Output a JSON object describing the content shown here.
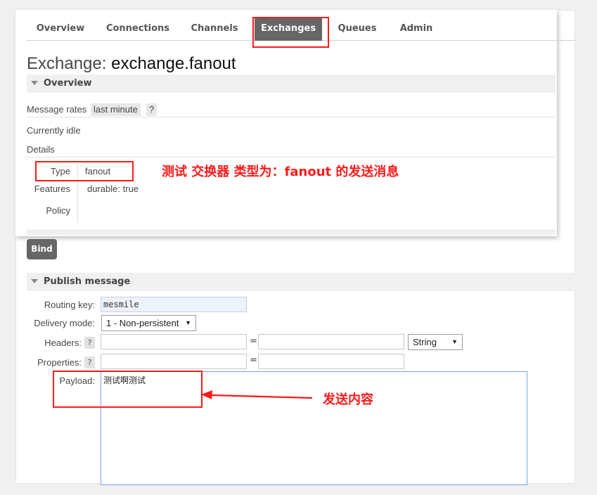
{
  "nav": {
    "tabs": [
      {
        "label": "Overview",
        "active": false
      },
      {
        "label": "Connections",
        "active": false
      },
      {
        "label": "Channels",
        "active": false
      },
      {
        "label": "Exchanges",
        "active": true
      },
      {
        "label": "Queues",
        "active": false
      },
      {
        "label": "Admin",
        "active": false
      }
    ]
  },
  "page": {
    "title_prefix": "Exchange:",
    "title_name": "exchange.fanout"
  },
  "overview": {
    "heading": "Overview",
    "message_rates_label": "Message rates",
    "message_rates_value": "last minute",
    "help": "?",
    "idle_text": "Currently idle",
    "details_label": "Details",
    "type_label": "Type",
    "type_value": "fanout",
    "features_label": "Features",
    "features_key": "durable:",
    "features_value": "true",
    "policy_label": "Policy"
  },
  "bind_button": "Bind",
  "publish": {
    "heading": "Publish message",
    "routing_key_label": "Routing key:",
    "routing_key_value": "mesmile",
    "delivery_mode_label": "Delivery mode:",
    "delivery_mode_value": "1 - Non-persistent",
    "headers_label": "Headers:",
    "headers_help": "?",
    "headers_type": "String",
    "equals": "=",
    "properties_label": "Properties:",
    "properties_help": "?",
    "payload_label": "Payload:",
    "payload_value": "测试啊测试"
  },
  "annotations": {
    "type_note": "测试 交换器 类型为：fanout 的发送消息",
    "payload_note": "发送内容"
  },
  "colors": {
    "annotation_red": "#ff1a1a",
    "active_tab": "#666666",
    "payload_border": "#7aa2e6"
  }
}
